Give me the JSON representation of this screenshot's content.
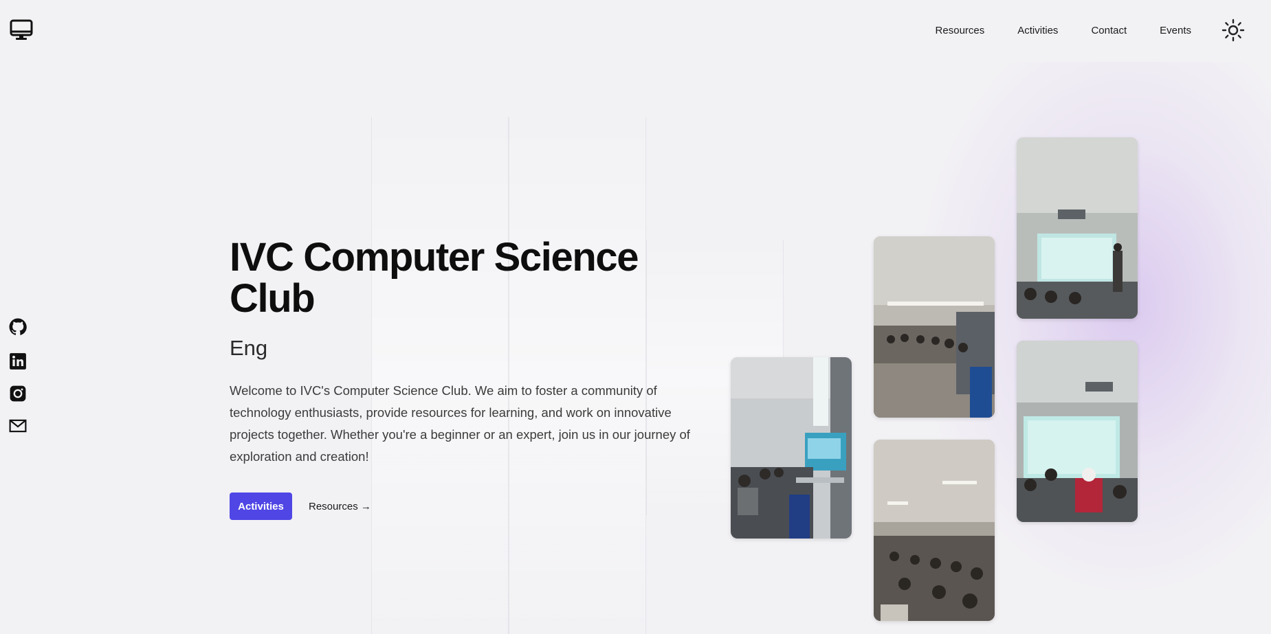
{
  "brand": {
    "logo_icon": "desktop-monitor-icon"
  },
  "nav": {
    "items": [
      {
        "label": "Resources"
      },
      {
        "label": "Activities"
      },
      {
        "label": "Contact"
      },
      {
        "label": "Events"
      }
    ],
    "theme_icon": "sun-icon"
  },
  "social": {
    "icons": [
      "github-icon",
      "linkedin-icon",
      "instagram-icon",
      "mail-icon"
    ]
  },
  "hero": {
    "title": "IVC Computer Science Club",
    "subtitle": "Eng",
    "description": "Welcome to IVC's Computer Science Club. We aim to foster a community of technology enthusiasts, provide resources for learning, and work on innovative projects together. Whether you're a beginner or an expert, join us in our journey of exploration and creation!",
    "primary_button": "Activities",
    "secondary_link": "Resources →"
  },
  "colors": {
    "accent": "#4f46e5",
    "background": "#f2f1f4",
    "text": "#0e0e0e"
  }
}
